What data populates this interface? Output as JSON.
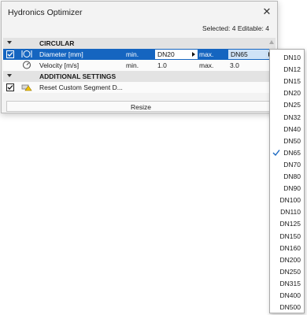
{
  "window": {
    "title": "Hydronics Optimizer",
    "close_symbol": "✕"
  },
  "selection_info": "Selected: 4 Editable: 4",
  "groups": {
    "circular": "CIRCULAR",
    "additional": "ADDITIONAL SETTINGS"
  },
  "rows": {
    "diameter": {
      "name": "Diameter [mm]",
      "min_label": "min.",
      "min_value": "DN20",
      "max_label": "max.",
      "max_value": "DN65",
      "icon": "diameter-icon",
      "checked": true
    },
    "velocity": {
      "name": "Velocity [m/s]",
      "min_label": "min.",
      "min_value": "1.0",
      "max_label": "max.",
      "max_value": "3.0",
      "icon": "gauge-icon"
    },
    "reset": {
      "name": "Reset Custom Segment D...",
      "icon": "segment-warning-icon",
      "checked": true
    }
  },
  "resize_label": "Resize",
  "dropdown": {
    "selected": "DN65",
    "options": [
      "DN10",
      "DN12",
      "DN15",
      "DN20",
      "DN25",
      "DN32",
      "DN40",
      "DN50",
      "DN65",
      "DN70",
      "DN80",
      "DN90",
      "DN100",
      "DN110",
      "DN125",
      "DN150",
      "DN160",
      "DN200",
      "DN250",
      "DN315",
      "DN400",
      "DN500"
    ]
  },
  "colors": {
    "selection": "#1565c0",
    "accent": "#1565c0"
  }
}
